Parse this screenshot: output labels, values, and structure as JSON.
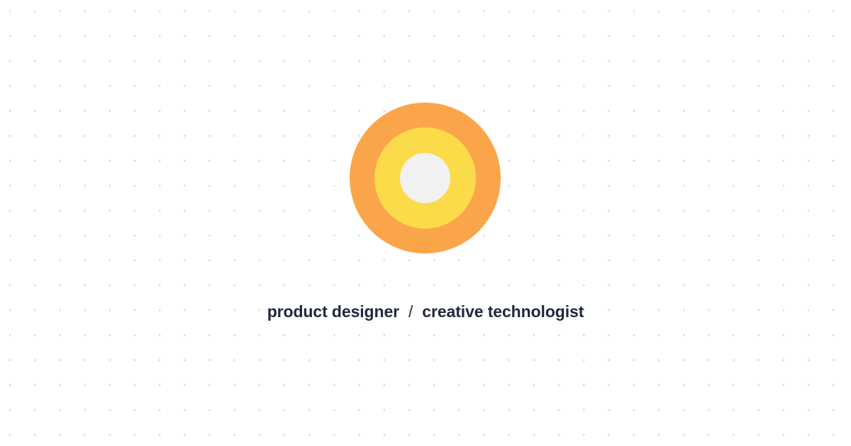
{
  "logo": {
    "icon": "concentric-circles-logo",
    "colors": {
      "outer": "#FBA54A",
      "middle": "#FCDB4A",
      "inner": "#F1F1F1"
    }
  },
  "tagline": {
    "role_primary": "product designer",
    "separator": "/",
    "role_secondary": "creative technologist",
    "color": "#1e293b"
  },
  "background": {
    "color": "#ffffff",
    "dot_color": "#d6d6d6"
  }
}
